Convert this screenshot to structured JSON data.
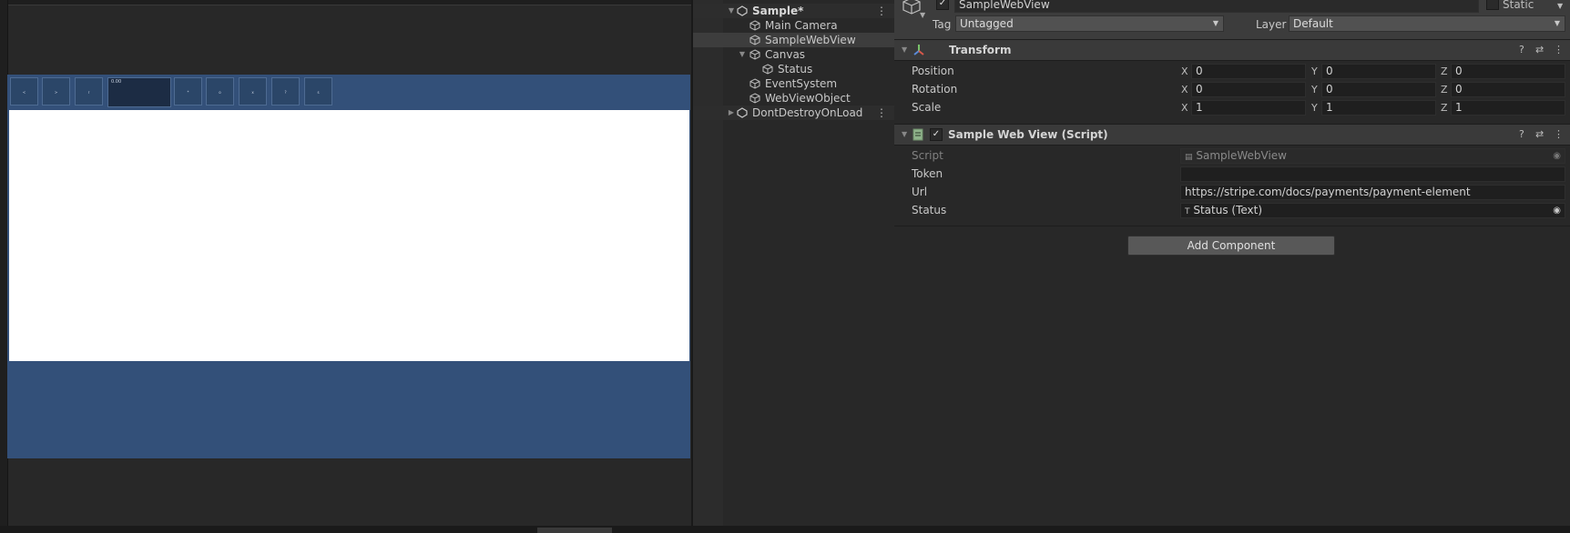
{
  "game_view": {
    "toolbar_buttons": [
      "<",
      ">",
      "r",
      "*",
      "o",
      "x",
      "?",
      "s"
    ],
    "url_field": "0.00"
  },
  "hierarchy": {
    "scene": "Sample*",
    "items": [
      {
        "label": "Main Camera"
      },
      {
        "label": "SampleWebView"
      },
      {
        "label": "Canvas"
      },
      {
        "label": "Status"
      },
      {
        "label": "EventSystem"
      },
      {
        "label": "WebViewObject"
      }
    ],
    "dont_destroy": "DontDestroyOnLoad"
  },
  "inspector": {
    "object_name": "SampleWebView",
    "static_label": "Static",
    "tag_label": "Tag",
    "tag_value": "Untagged",
    "layer_label": "Layer",
    "layer_value": "Default",
    "transform": {
      "title": "Transform",
      "position_label": "Position",
      "rotation_label": "Rotation",
      "scale_label": "Scale",
      "axes": [
        "X",
        "Y",
        "Z"
      ],
      "position": [
        "0",
        "0",
        "0"
      ],
      "rotation": [
        "0",
        "0",
        "0"
      ],
      "scale": [
        "1",
        "1",
        "1"
      ]
    },
    "script_component": {
      "title": "Sample Web View (Script)",
      "script_label": "Script",
      "script_value": "SampleWebView",
      "token_label": "Token",
      "token_value": "",
      "url_label": "Url",
      "url_value": "https://stripe.com/docs/payments/payment-element",
      "status_label": "Status",
      "status_value": "Status (Text)"
    },
    "add_component": "Add Component"
  },
  "colors": {
    "game_background": "#335079",
    "webview": "#ffffff",
    "editor_bg": "#282828",
    "selection": "#3d3d3d"
  }
}
